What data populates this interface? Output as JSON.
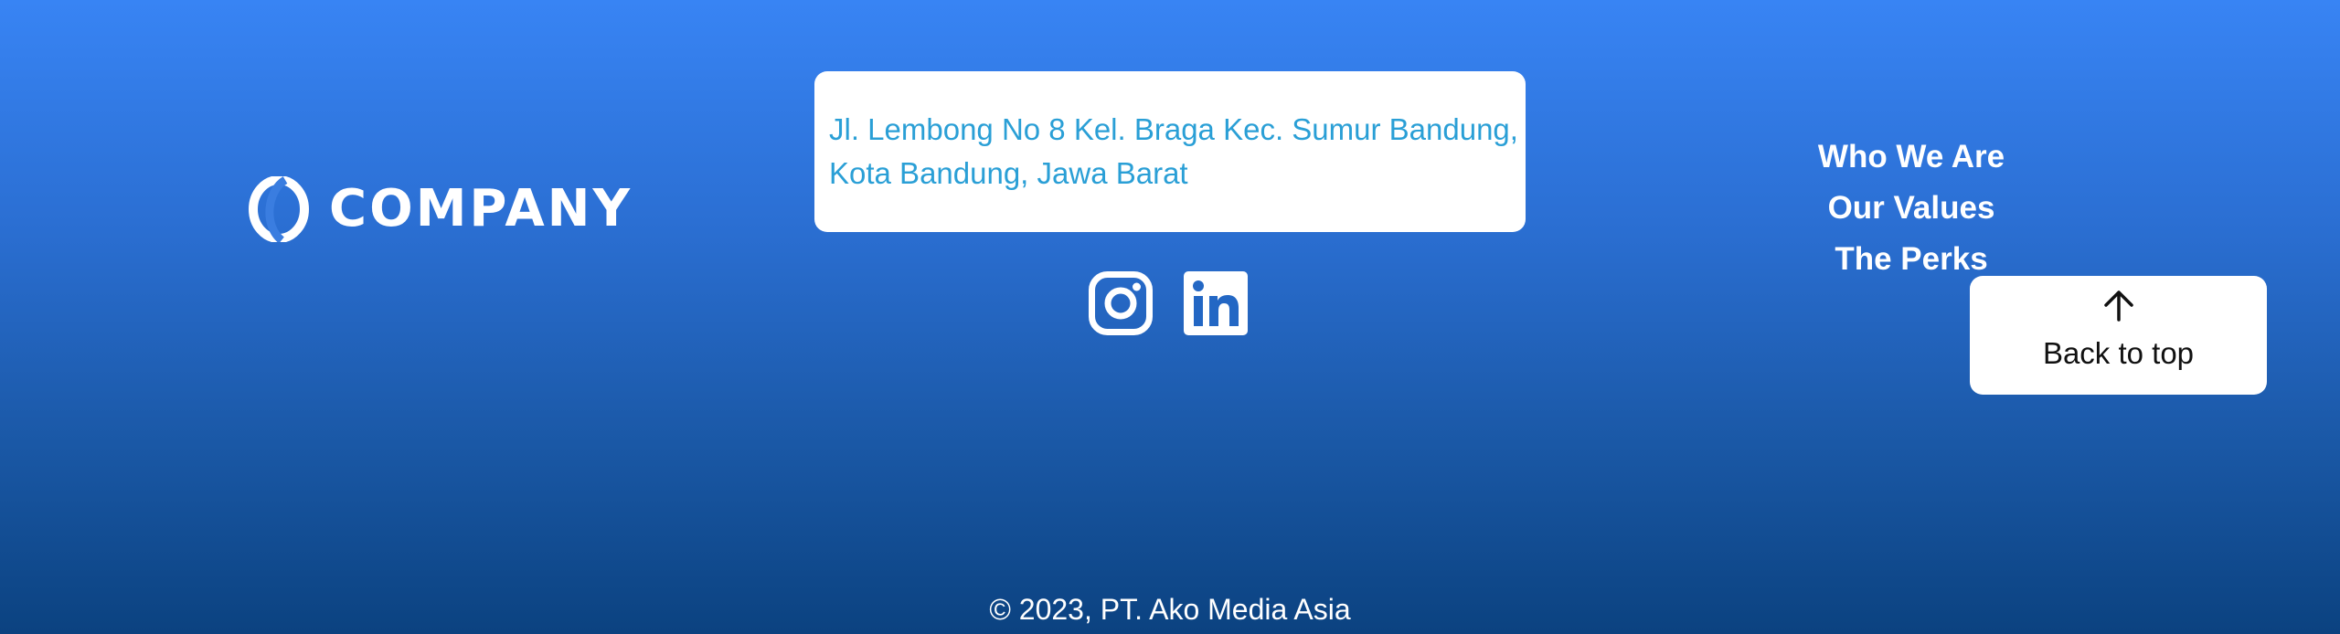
{
  "brand": {
    "name": "COMPANY",
    "icon": "company-logo-icon"
  },
  "address": {
    "line1": "Jl. Lembong No 8 Kel. Braga Kec. Sumur Bandung,",
    "line2": "Kota Bandung, Jawa Barat",
    "color": "#2a9fd6"
  },
  "social": [
    {
      "icon": "instagram-icon"
    },
    {
      "icon": "linkedin-icon"
    }
  ],
  "nav": {
    "items": [
      {
        "label": "Who We Are"
      },
      {
        "label": "Our Values"
      },
      {
        "label": "The Perks"
      }
    ]
  },
  "back_to_top": {
    "label": "Back to top",
    "icon": "arrow-up-icon"
  },
  "footer": {
    "copyright": "© 2023, PT. Ako Media Asia"
  },
  "colors": {
    "gradient_top": "#3884f4",
    "gradient_bottom": "#0b4280"
  }
}
